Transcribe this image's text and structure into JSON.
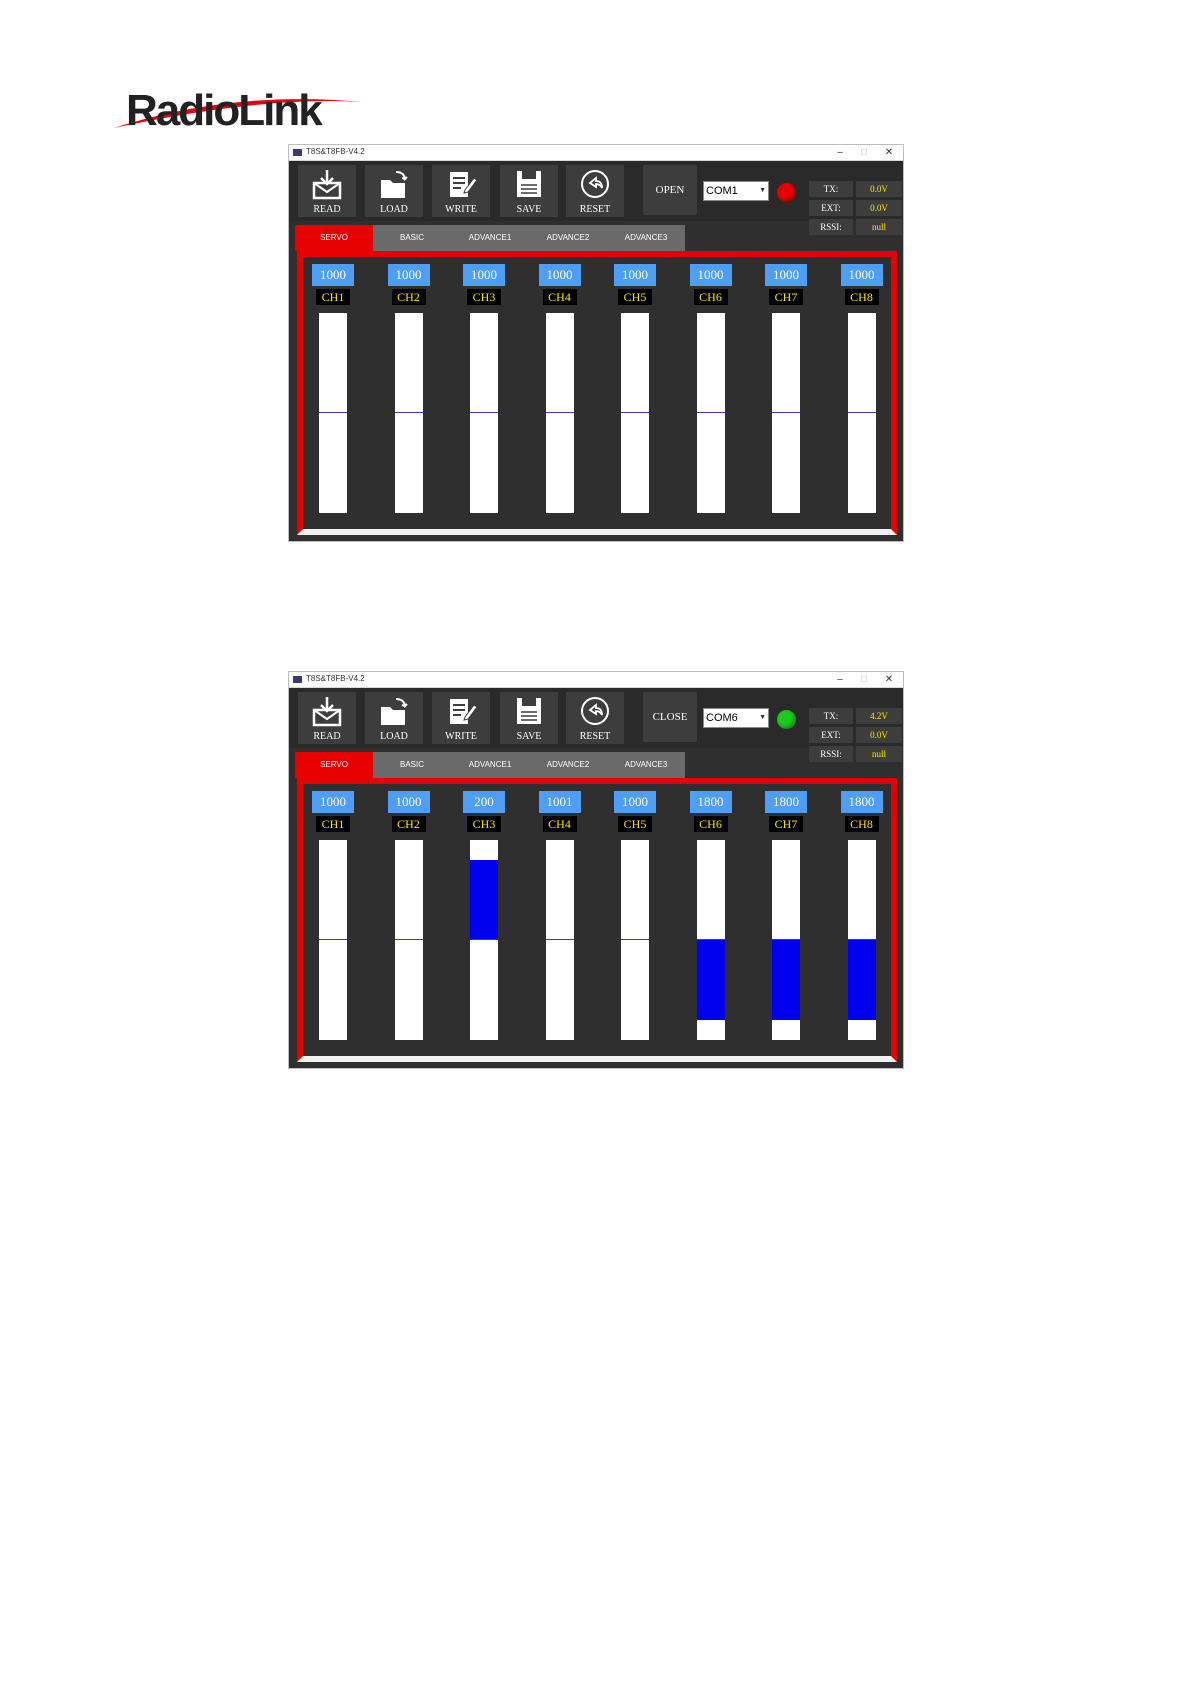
{
  "logo": {
    "text": "RadioLink",
    "color": "#e60012"
  },
  "windows": [
    {
      "title": "T8S&T8FB-V4.2",
      "controls": {
        "minimize": "–",
        "maximize": "□",
        "close": "✕"
      },
      "toolbar": [
        {
          "label": "READ",
          "icon": "envelope-download-icon"
        },
        {
          "label": "LOAD",
          "icon": "folder-open-icon"
        },
        {
          "label": "WRITE",
          "icon": "pen-document-icon"
        },
        {
          "label": "SAVE",
          "icon": "floppy-disk-icon"
        },
        {
          "label": "RESET",
          "icon": "reset-arrow-icon"
        }
      ],
      "connect_label": "OPEN",
      "port": "COM1",
      "status_color": "#e60000",
      "telemetry": [
        {
          "label": "TX:",
          "value": "0.0V"
        },
        {
          "label": "EXT:",
          "value": "0.0V"
        },
        {
          "label": "RSSI:",
          "value": "null"
        }
      ],
      "tabs": [
        "SERVO",
        "BASIC",
        "ADVANCE1",
        "ADVANCE2",
        "ADVANCE3"
      ],
      "active_tab": "SERVO",
      "channels": [
        {
          "name": "CH1",
          "value": "1000",
          "fill_from": 0.5,
          "fill_to": 0.5
        },
        {
          "name": "CH2",
          "value": "1000",
          "fill_from": 0.5,
          "fill_to": 0.5
        },
        {
          "name": "CH3",
          "value": "1000",
          "fill_from": 0.5,
          "fill_to": 0.5
        },
        {
          "name": "CH4",
          "value": "1000",
          "fill_from": 0.5,
          "fill_to": 0.5
        },
        {
          "name": "CH5",
          "value": "1000",
          "fill_from": 0.5,
          "fill_to": 0.5
        },
        {
          "name": "CH6",
          "value": "1000",
          "fill_from": 0.5,
          "fill_to": 0.5
        },
        {
          "name": "CH7",
          "value": "1000",
          "fill_from": 0.5,
          "fill_to": 0.5
        },
        {
          "name": "CH8",
          "value": "1000",
          "fill_from": 0.5,
          "fill_to": 0.5
        }
      ]
    },
    {
      "title": "T8S&T8FB-V4.2",
      "controls": {
        "minimize": "–",
        "maximize": "□",
        "close": "✕"
      },
      "toolbar": [
        {
          "label": "READ",
          "icon": "envelope-download-icon"
        },
        {
          "label": "LOAD",
          "icon": "folder-open-icon"
        },
        {
          "label": "WRITE",
          "icon": "pen-document-icon"
        },
        {
          "label": "SAVE",
          "icon": "floppy-disk-icon"
        },
        {
          "label": "RESET",
          "icon": "reset-arrow-icon"
        }
      ],
      "connect_label": "CLOSE",
      "port": "COM6",
      "status_color": "#1ec81e",
      "telemetry": [
        {
          "label": "TX:",
          "value": "4.2V"
        },
        {
          "label": "EXT:",
          "value": "0.0V"
        },
        {
          "label": "RSSI:",
          "value": "null"
        }
      ],
      "tabs": [
        "SERVO",
        "BASIC",
        "ADVANCE1",
        "ADVANCE2",
        "ADVANCE3"
      ],
      "active_tab": "SERVO",
      "channels": [
        {
          "name": "CH1",
          "value": "1000",
          "fill_from": 0.5,
          "fill_to": 0.5
        },
        {
          "name": "CH2",
          "value": "1000",
          "fill_from": 0.5,
          "fill_to": 0.5
        },
        {
          "name": "CH3",
          "value": "200",
          "fill_from": 0.1,
          "fill_to": 0.5
        },
        {
          "name": "CH4",
          "value": "1001",
          "fill_from": 0.5,
          "fill_to": 0.5
        },
        {
          "name": "CH5",
          "value": "1000",
          "fill_from": 0.5,
          "fill_to": 0.5
        },
        {
          "name": "CH6",
          "value": "1800",
          "fill_from": 0.5,
          "fill_to": 0.9
        },
        {
          "name": "CH7",
          "value": "1800",
          "fill_from": 0.5,
          "fill_to": 0.9
        },
        {
          "name": "CH8",
          "value": "1800",
          "fill_from": 0.5,
          "fill_to": 0.9
        }
      ]
    }
  ]
}
